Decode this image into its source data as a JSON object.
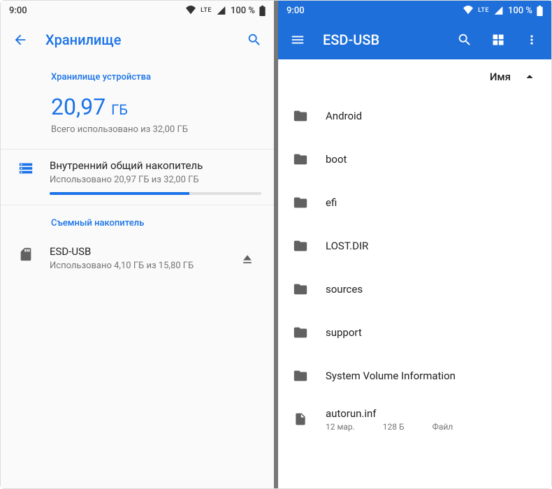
{
  "status": {
    "time": "9:00",
    "battery": "100 %",
    "net": "LTE"
  },
  "left": {
    "title": "Хранилище",
    "section_device": "Хранилище устройства",
    "used_value": "20,97",
    "used_unit": "ГБ",
    "used_subtitle": "Всего использовано из 32,00 ГБ",
    "internal": {
      "name": "Внутренний общий накопитель",
      "sub": "Использовано 20,97 ГБ из 32,00 ГБ",
      "percent": 66
    },
    "section_removable": "Съемный накопитель",
    "removable": {
      "name": "ESD-USB",
      "sub": "Использовано 4,10 ГБ из 15,80 ГБ"
    }
  },
  "right": {
    "title": "ESD-USB",
    "sort_label": "Имя",
    "items": [
      {
        "type": "folder",
        "name": "Android"
      },
      {
        "type": "folder",
        "name": "boot"
      },
      {
        "type": "folder",
        "name": "efi"
      },
      {
        "type": "folder",
        "name": "LOST.DIR"
      },
      {
        "type": "folder",
        "name": "sources"
      },
      {
        "type": "folder",
        "name": "support"
      },
      {
        "type": "folder",
        "name": "System Volume Information"
      },
      {
        "type": "file",
        "name": "autorun.inf",
        "date": "12 мар.",
        "size": "128 Б",
        "kind": "Файл"
      }
    ]
  }
}
